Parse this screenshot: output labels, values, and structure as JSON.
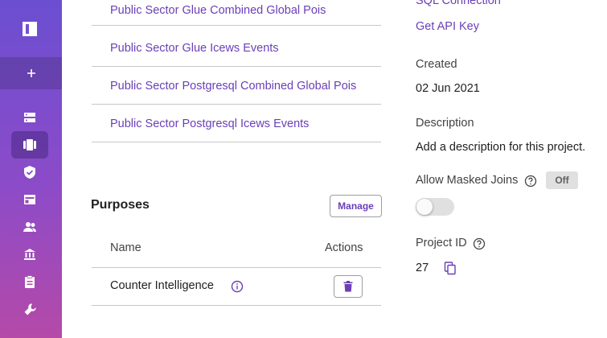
{
  "datasets": [
    {
      "label": "Public Sector Glue Combined Global Pois"
    },
    {
      "label": "Public Sector Glue Icews Events"
    },
    {
      "label": "Public Sector Postgresql Combined Global Pois"
    },
    {
      "label": "Public Sector Postgresql Icews Events"
    }
  ],
  "purposes": {
    "title": "Purposes",
    "manage_label": "Manage",
    "columns": {
      "name": "Name",
      "actions": "Actions"
    },
    "rows": [
      {
        "name": "Counter Intelligence"
      }
    ]
  },
  "details": {
    "sql_connection_label": "SQL Connection",
    "get_api_key_label": "Get API Key",
    "created_label": "Created",
    "created_value": "02 Jun 2021",
    "description_label": "Description",
    "description_value": "Add a description for this project.",
    "masked_joins_label": "Allow Masked Joins",
    "masked_joins_state": "Off",
    "project_id_label": "Project ID",
    "project_id_value": "27"
  },
  "sidebar": {
    "icons": [
      "logo-icon",
      "add-icon",
      "storage-icon",
      "projects-icon",
      "policies-icon",
      "dashboard-icon",
      "users-icon",
      "governance-icon",
      "audit-icon",
      "settings-icon"
    ],
    "active": "projects-icon"
  },
  "colors": {
    "accent": "#6a3fb8",
    "sidebar_top": "#6b4fd0",
    "sidebar_bottom": "#b54aa8"
  }
}
